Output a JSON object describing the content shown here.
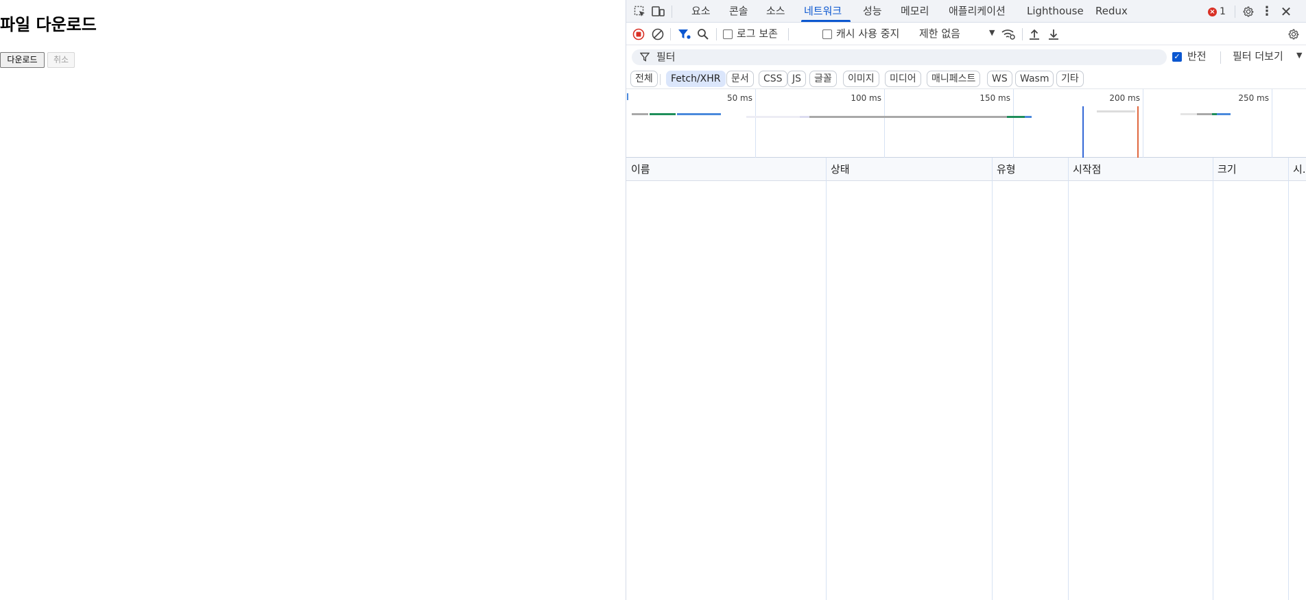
{
  "page": {
    "title": "파일 다운로드",
    "download_button": "다운로드",
    "cancel_button": "취소"
  },
  "devtools": {
    "tabs": [
      "요소",
      "콘솔",
      "소스",
      "네트워크",
      "성능",
      "메모리",
      "애플리케이션",
      "Lighthouse",
      "Redux"
    ],
    "active_tab": "네트워크",
    "error_count": "1",
    "toolbar": {
      "preserve_log": "로그 보존",
      "disable_cache": "캐시 사용 중지",
      "throttling": "제한 없음"
    },
    "filter": {
      "placeholder": "필터",
      "invert": "반전",
      "more_filters": "필터 더보기"
    },
    "type_filters": [
      "전체",
      "Fetch/XHR",
      "문서",
      "CSS",
      "JS",
      "글꼴",
      "이미지",
      "미디어",
      "매니페스트",
      "WS",
      "Wasm",
      "기타"
    ],
    "active_type_filter": "Fetch/XHR",
    "timeline": {
      "ticks": [
        "50 ms",
        "100 ms",
        "150 ms",
        "200 ms",
        "250 ms"
      ]
    },
    "columns": [
      "이름",
      "상태",
      "유형",
      "시작점",
      "크기",
      "시..."
    ]
  },
  "colors": {
    "accent": "#0b57d0",
    "error": "#d93025",
    "waterfall_blue": "#4a89dc",
    "waterfall_green": "#1e8e5a",
    "waterfall_gray": "#a8a8a8",
    "dom_content_loaded": "#3367d6",
    "load_event": "#e0683f"
  }
}
